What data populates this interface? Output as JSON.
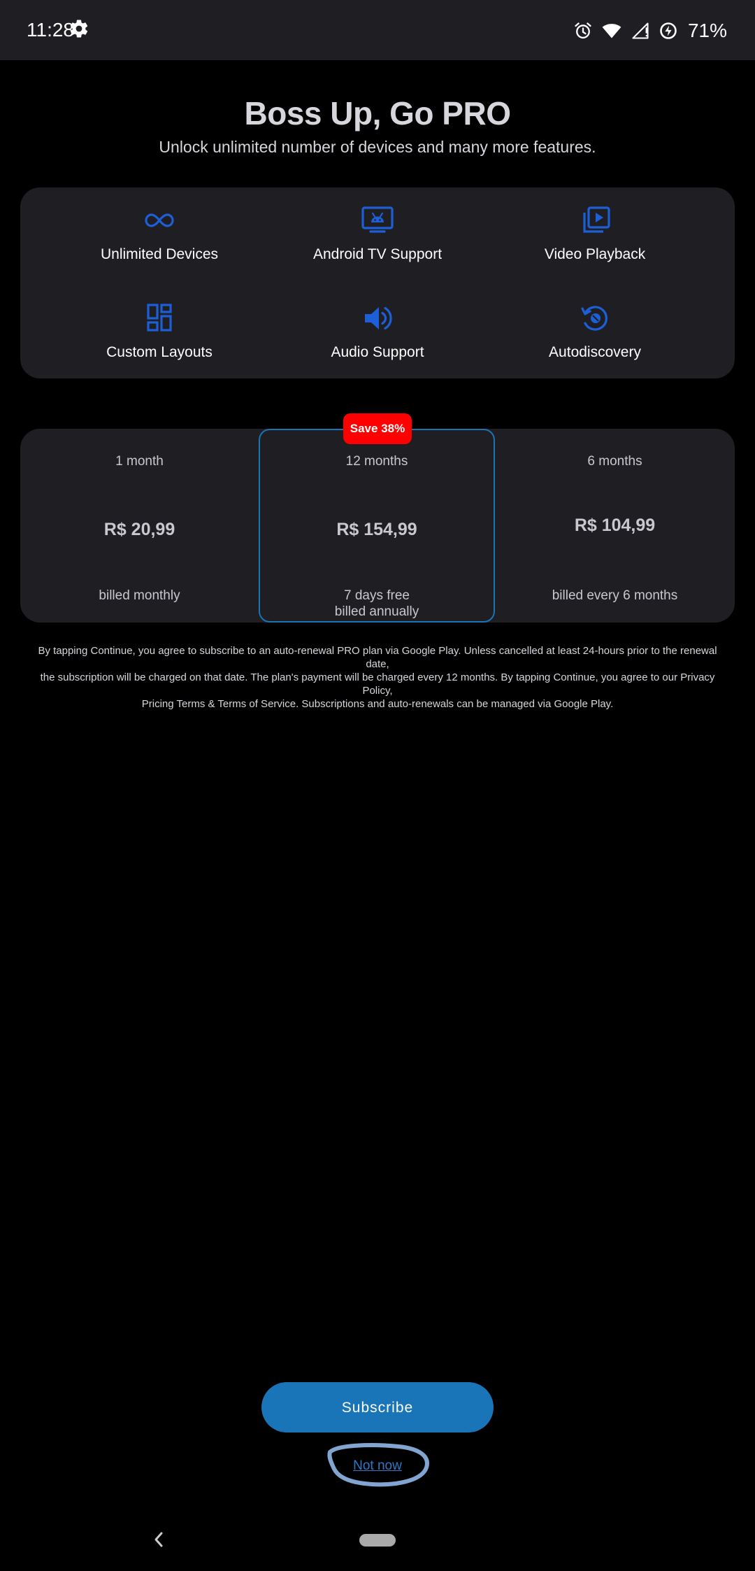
{
  "status_bar": {
    "time": "11:28",
    "battery": "71%",
    "icons": [
      "gear-icon",
      "alarm-icon",
      "wifi-icon",
      "signal-icon",
      "battery-saver-icon"
    ]
  },
  "header": {
    "title": "Boss Up, Go PRO",
    "subtitle": "Unlock unlimited number of devices and many more features."
  },
  "features": [
    {
      "label": "Unlimited Devices",
      "icon": "infinity-icon"
    },
    {
      "label": "Android TV Support",
      "icon": "android-tv-icon"
    },
    {
      "label": "Video Playback",
      "icon": "video-playback-icon"
    },
    {
      "label": "Custom Layouts",
      "icon": "dashboard-layout-icon"
    },
    {
      "label": "Audio Support",
      "icon": "speaker-icon"
    },
    {
      "label": "Autodiscovery",
      "icon": "autodiscovery-icon"
    }
  ],
  "plans": [
    {
      "term": "1 month",
      "price": "R$ 20,99",
      "billing_line1": "billed monthly",
      "billing_line2": ""
    },
    {
      "term": "12 months",
      "price": "R$ 154,99",
      "billing_line1": "7 days free",
      "billing_line2": "billed annually",
      "badge": "Save 38%",
      "selected": true
    },
    {
      "term": "6 months",
      "price": "R$ 104,99",
      "billing_line1": "billed every 6 months",
      "billing_line2": ""
    }
  ],
  "legal": {
    "line1": "By tapping Continue, you agree to subscribe to an auto-renewal PRO plan via Google Play. Unless cancelled at least 24-hours prior to the renewal date,",
    "line2": "the subscription will be charged on that date. The plan's payment will be charged every 12 months. By tapping Continue, you agree to our Privacy Policy,",
    "line3": "Pricing Terms & Terms of Service. Subscriptions and auto-renewals can be managed via Google Play."
  },
  "actions": {
    "subscribe": "Subscribe",
    "not_now": "Not now"
  },
  "colors": {
    "accent": "#1a74b8",
    "icon_blue": "#1d5fd6",
    "badge_red": "#ff0000",
    "panel": "#1f1e23",
    "background": "#000000"
  }
}
